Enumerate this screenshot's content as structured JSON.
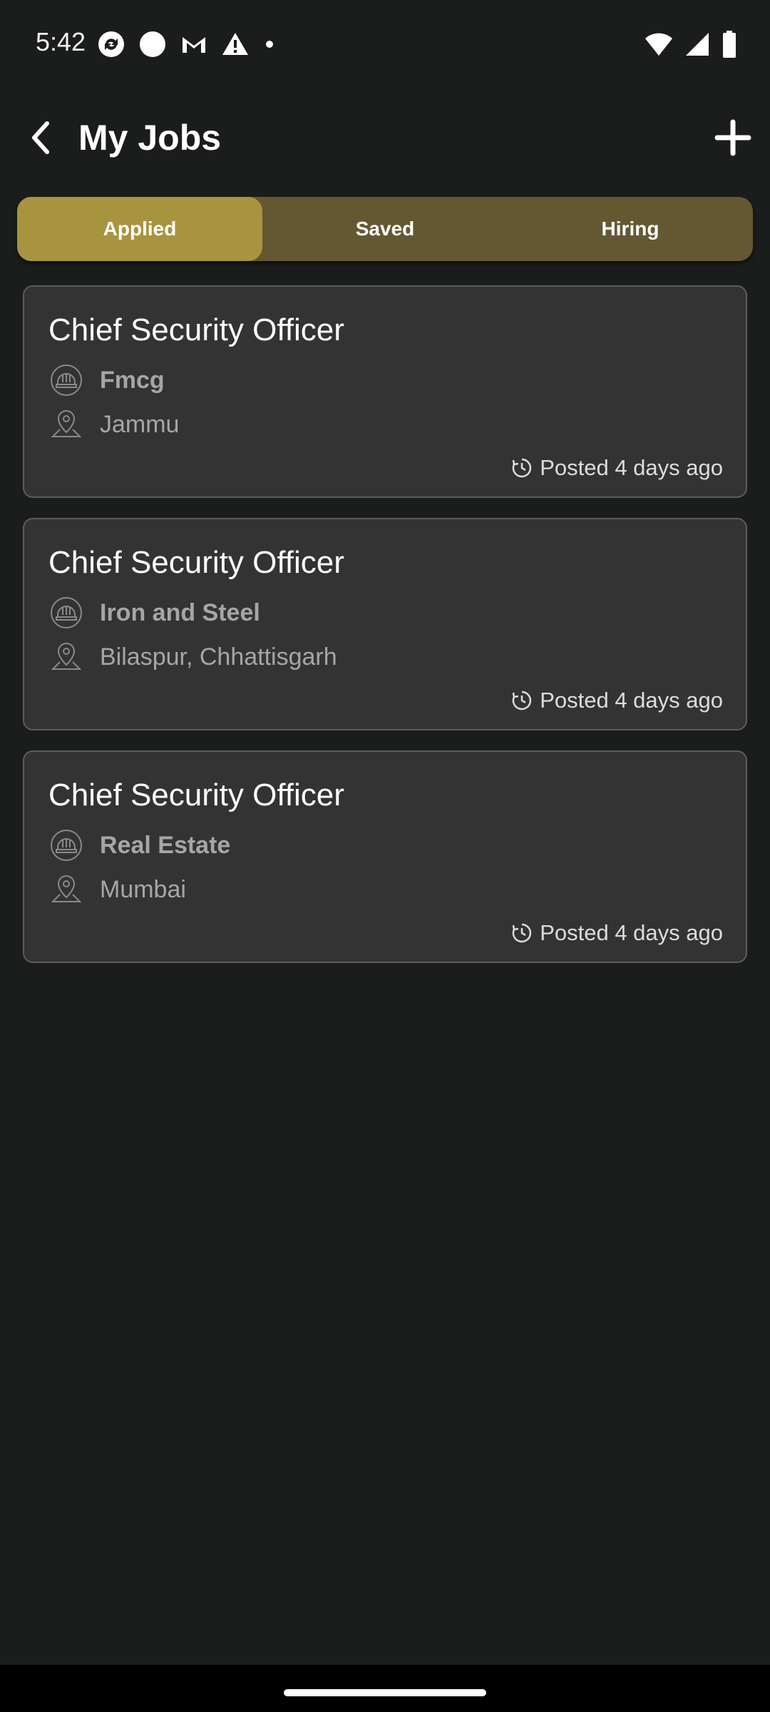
{
  "status_bar": {
    "time": "5:42"
  },
  "header": {
    "title": "My Jobs"
  },
  "tabs": [
    {
      "label": "Applied",
      "active": true
    },
    {
      "label": "Saved",
      "active": false
    },
    {
      "label": "Hiring",
      "active": false
    }
  ],
  "jobs": [
    {
      "title": "Chief Security Officer",
      "industry": "Fmcg",
      "location": "Jammu",
      "posted": "Posted 4 days ago"
    },
    {
      "title": "Chief Security Officer",
      "industry": "Iron and Steel",
      "location": "Bilaspur, Chhattisgarh",
      "posted": "Posted 4 days ago"
    },
    {
      "title": "Chief Security Officer",
      "industry": "Real Estate",
      "location": "Mumbai",
      "posted": "Posted 4 days ago"
    }
  ],
  "colors": {
    "background": "#1b1c1c",
    "tab_bar": "#645833",
    "tab_active": "#a8943f",
    "card": "#333333"
  },
  "icons": {
    "back": "back-arrow-icon",
    "add": "plus-icon",
    "industry": "hard-hat-icon",
    "location": "location-pin-icon",
    "posted": "clock-icon"
  }
}
